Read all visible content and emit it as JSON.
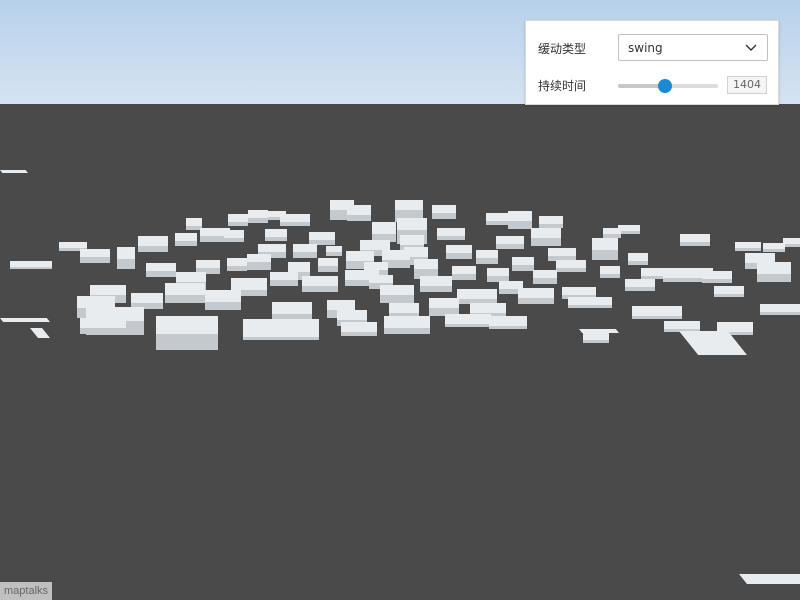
{
  "controls": {
    "easing_label": "缓动类型",
    "easing_value": "swing",
    "duration_label": "持续时间",
    "duration_value": "1404",
    "duration_fraction": 0.47
  },
  "attribution": "maptalks",
  "colors": {
    "sky": "#c9dcef",
    "ground": "#4a4a4a",
    "building_top": "#e8ecef",
    "building_side": "#c4c9cd",
    "accent": "#1a8ad4"
  }
}
